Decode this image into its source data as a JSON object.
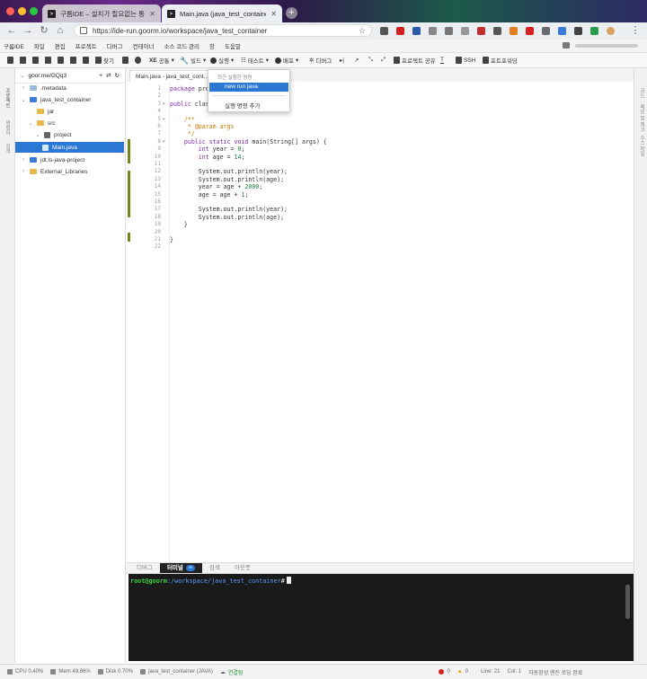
{
  "browser": {
    "tabs": [
      {
        "title": "구름IDE – 설치가 필요없는 통합개발환경",
        "active": false
      },
      {
        "title": "Main.java (java_test_container)",
        "active": true
      }
    ],
    "url": "https://ide-run.goorm.io/workspace/java_test_container"
  },
  "menu": [
    "구름IDE",
    "파일",
    "편집",
    "프로젝트",
    "디버그",
    "컨테이너",
    "소스 코드 관리",
    "창",
    "도움말"
  ],
  "toolbar": {
    "find": "찾기",
    "common": "공통",
    "build": "빌드",
    "run": "실행",
    "test": "테스트",
    "deploy": "배포",
    "debug": "디버그",
    "share": "프로젝트 공유",
    "ssh": "SSH",
    "port_forwarding": "포트포워딩"
  },
  "side_labels": {
    "left": [
      "프로젝트",
      "명령어",
      "검색"
    ],
    "right": [
      "코드",
      "메모 및 체크",
      "소스 파일"
    ]
  },
  "tree": {
    "root": "goor.me/GQq3",
    "items": [
      {
        "label": ".metadata",
        "depth": 1,
        "expanded": false,
        "selected": false
      },
      {
        "label": "java_test_container",
        "depth": 1,
        "expanded": true,
        "selected": false
      },
      {
        "label": "jar",
        "depth": 2,
        "expanded": false,
        "selected": false
      },
      {
        "label": "src",
        "depth": 2,
        "expanded": true,
        "selected": false
      },
      {
        "label": "project",
        "depth": 3,
        "expanded": true,
        "selected": false
      },
      {
        "label": "Main.java",
        "depth": 4,
        "expanded": false,
        "selected": true
      },
      {
        "label": "jdt.ls-java-project",
        "depth": 1,
        "expanded": false,
        "selected": false
      },
      {
        "label": "External_Libraries",
        "depth": 1,
        "expanded": false,
        "selected": false
      }
    ]
  },
  "editor": {
    "tab_label": "Main.java - java_test_cont...",
    "active_line": 21,
    "lines": [
      "package pro",
      "",
      "public clas",
      "",
      "    /**",
      "     * @param args",
      "     */",
      "    public static void main(String[] args) {",
      "        int year = 0;",
      "        int age = 14;",
      "",
      "        System.out.println(year);",
      "        System.out.println(age);",
      "        year = age + 2000;",
      "        age = age + 1;",
      "",
      "        System.out.println(year);",
      "        System.out.println(age);",
      "    }",
      "",
      "}",
      ""
    ]
  },
  "run_dropdown": {
    "section": "최근 실행한 명령",
    "item": "new run java",
    "add": "실행 명령 추가"
  },
  "bottom_panel": {
    "tabs": [
      "디버그",
      "터미널",
      "검색",
      "아웃풋"
    ],
    "active_tab": "터미널",
    "terminal_user": "root@goorm",
    "terminal_path": ":/workspace/java_test_container",
    "terminal_prompt": "#"
  },
  "status": {
    "cpu": "CPU 0.40%",
    "mem": "Mem 49.86%",
    "disk": "Disk 0.70%",
    "project": "java_test_container (JAVA)",
    "connection": "연결됨",
    "errors": "0",
    "warnings": "0",
    "line": "Line: 21",
    "col": "Col: 1",
    "autosave": "자동완성 엔진 로딩 완료"
  },
  "colors": {
    "accent": "#2b78d4",
    "terminal_bg": "#1a1a1a",
    "terminal_user": "#3fd23f",
    "modified_bar": "#6e8a1e"
  }
}
